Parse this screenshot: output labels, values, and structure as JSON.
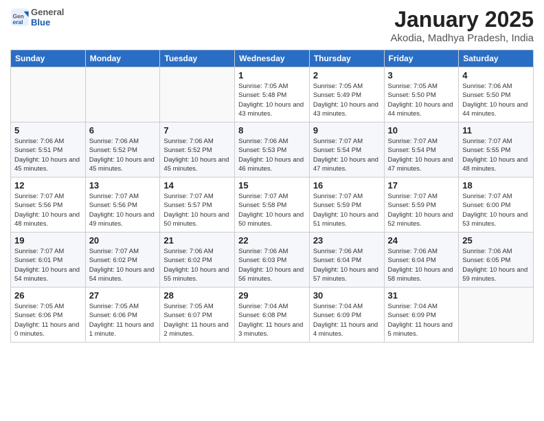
{
  "header": {
    "logo_general": "General",
    "logo_blue": "Blue",
    "title": "January 2025",
    "location": "Akodia, Madhya Pradesh, India"
  },
  "days_of_week": [
    "Sunday",
    "Monday",
    "Tuesday",
    "Wednesday",
    "Thursday",
    "Friday",
    "Saturday"
  ],
  "weeks": [
    [
      {
        "day": "",
        "detail": ""
      },
      {
        "day": "",
        "detail": ""
      },
      {
        "day": "",
        "detail": ""
      },
      {
        "day": "1",
        "detail": "Sunrise: 7:05 AM\nSunset: 5:48 PM\nDaylight: 10 hours and 43 minutes."
      },
      {
        "day": "2",
        "detail": "Sunrise: 7:05 AM\nSunset: 5:49 PM\nDaylight: 10 hours and 43 minutes."
      },
      {
        "day": "3",
        "detail": "Sunrise: 7:05 AM\nSunset: 5:50 PM\nDaylight: 10 hours and 44 minutes."
      },
      {
        "day": "4",
        "detail": "Sunrise: 7:06 AM\nSunset: 5:50 PM\nDaylight: 10 hours and 44 minutes."
      }
    ],
    [
      {
        "day": "5",
        "detail": "Sunrise: 7:06 AM\nSunset: 5:51 PM\nDaylight: 10 hours and 45 minutes."
      },
      {
        "day": "6",
        "detail": "Sunrise: 7:06 AM\nSunset: 5:52 PM\nDaylight: 10 hours and 45 minutes."
      },
      {
        "day": "7",
        "detail": "Sunrise: 7:06 AM\nSunset: 5:52 PM\nDaylight: 10 hours and 45 minutes."
      },
      {
        "day": "8",
        "detail": "Sunrise: 7:06 AM\nSunset: 5:53 PM\nDaylight: 10 hours and 46 minutes."
      },
      {
        "day": "9",
        "detail": "Sunrise: 7:07 AM\nSunset: 5:54 PM\nDaylight: 10 hours and 47 minutes."
      },
      {
        "day": "10",
        "detail": "Sunrise: 7:07 AM\nSunset: 5:54 PM\nDaylight: 10 hours and 47 minutes."
      },
      {
        "day": "11",
        "detail": "Sunrise: 7:07 AM\nSunset: 5:55 PM\nDaylight: 10 hours and 48 minutes."
      }
    ],
    [
      {
        "day": "12",
        "detail": "Sunrise: 7:07 AM\nSunset: 5:56 PM\nDaylight: 10 hours and 48 minutes."
      },
      {
        "day": "13",
        "detail": "Sunrise: 7:07 AM\nSunset: 5:56 PM\nDaylight: 10 hours and 49 minutes."
      },
      {
        "day": "14",
        "detail": "Sunrise: 7:07 AM\nSunset: 5:57 PM\nDaylight: 10 hours and 50 minutes."
      },
      {
        "day": "15",
        "detail": "Sunrise: 7:07 AM\nSunset: 5:58 PM\nDaylight: 10 hours and 50 minutes."
      },
      {
        "day": "16",
        "detail": "Sunrise: 7:07 AM\nSunset: 5:59 PM\nDaylight: 10 hours and 51 minutes."
      },
      {
        "day": "17",
        "detail": "Sunrise: 7:07 AM\nSunset: 5:59 PM\nDaylight: 10 hours and 52 minutes."
      },
      {
        "day": "18",
        "detail": "Sunrise: 7:07 AM\nSunset: 6:00 PM\nDaylight: 10 hours and 53 minutes."
      }
    ],
    [
      {
        "day": "19",
        "detail": "Sunrise: 7:07 AM\nSunset: 6:01 PM\nDaylight: 10 hours and 54 minutes."
      },
      {
        "day": "20",
        "detail": "Sunrise: 7:07 AM\nSunset: 6:02 PM\nDaylight: 10 hours and 54 minutes."
      },
      {
        "day": "21",
        "detail": "Sunrise: 7:06 AM\nSunset: 6:02 PM\nDaylight: 10 hours and 55 minutes."
      },
      {
        "day": "22",
        "detail": "Sunrise: 7:06 AM\nSunset: 6:03 PM\nDaylight: 10 hours and 56 minutes."
      },
      {
        "day": "23",
        "detail": "Sunrise: 7:06 AM\nSunset: 6:04 PM\nDaylight: 10 hours and 57 minutes."
      },
      {
        "day": "24",
        "detail": "Sunrise: 7:06 AM\nSunset: 6:04 PM\nDaylight: 10 hours and 58 minutes."
      },
      {
        "day": "25",
        "detail": "Sunrise: 7:06 AM\nSunset: 6:05 PM\nDaylight: 10 hours and 59 minutes."
      }
    ],
    [
      {
        "day": "26",
        "detail": "Sunrise: 7:05 AM\nSunset: 6:06 PM\nDaylight: 11 hours and 0 minutes."
      },
      {
        "day": "27",
        "detail": "Sunrise: 7:05 AM\nSunset: 6:06 PM\nDaylight: 11 hours and 1 minute."
      },
      {
        "day": "28",
        "detail": "Sunrise: 7:05 AM\nSunset: 6:07 PM\nDaylight: 11 hours and 2 minutes."
      },
      {
        "day": "29",
        "detail": "Sunrise: 7:04 AM\nSunset: 6:08 PM\nDaylight: 11 hours and 3 minutes."
      },
      {
        "day": "30",
        "detail": "Sunrise: 7:04 AM\nSunset: 6:09 PM\nDaylight: 11 hours and 4 minutes."
      },
      {
        "day": "31",
        "detail": "Sunrise: 7:04 AM\nSunset: 6:09 PM\nDaylight: 11 hours and 5 minutes."
      },
      {
        "day": "",
        "detail": ""
      }
    ]
  ]
}
